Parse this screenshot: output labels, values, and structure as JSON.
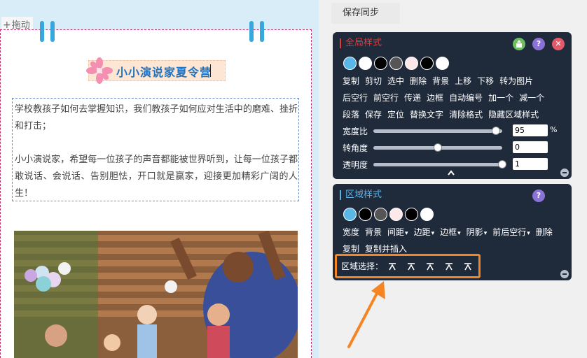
{
  "editor": {
    "drag_label": "拖动",
    "title": "小小演说家夏令营",
    "paragraph1": "学校教孩子如何去掌握知识，我们教孩子如何应对生活中的磨难、挫折和打击；",
    "paragraph2": "小小演说家，希望每一位孩子的声音都能被世界听到，让每一位孩子都敢说话、会说话、告别胆怯，开口就是赢家，迎接更加精彩广阔的人生！"
  },
  "toolbar": {
    "sync_label": "保存同步"
  },
  "global_panel": {
    "title": "全局样式",
    "swatch_colors": [
      "#5ab8e8",
      "#ffffff",
      "#000000",
      "#555555",
      "#fce8e8",
      "#000000",
      "#ffffff"
    ],
    "row1": [
      "复制",
      "剪切",
      "选中",
      "删除",
      "背景",
      "上移",
      "下移",
      "转为图片"
    ],
    "row2": [
      "后空行",
      "前空行",
      "传递",
      "边框",
      "自动编号",
      "加一个",
      "减一个"
    ],
    "row3": [
      "段落",
      "保存",
      "定位",
      "替换文字",
      "清除格式",
      "隐藏区域样式"
    ],
    "sliders": [
      {
        "label": "宽度比",
        "value": "95",
        "level": 0.95,
        "unit": "%"
      },
      {
        "label": "转角度",
        "value": "0",
        "level": 0.5,
        "unit": ""
      },
      {
        "label": "透明度",
        "value": "1",
        "level": 1.0,
        "unit": ""
      }
    ],
    "icons": {
      "a": "share-icon",
      "b": "help-icon",
      "c": "close-icon"
    },
    "help_glyph": "?",
    "close_glyph": "✕"
  },
  "region_panel": {
    "title": "区域样式",
    "help_glyph": "?",
    "swatch_colors": [
      "#5ab8e8",
      "#000000",
      "#555555",
      "#fce8e8",
      "#000000",
      "#ffffff"
    ],
    "row1": [
      "宽度",
      "背景",
      "间距",
      "边距",
      "边框",
      "阴影",
      "前后空行",
      "删除"
    ],
    "row1_dropdown": [
      false,
      false,
      true,
      true,
      true,
      true,
      true,
      false
    ],
    "row2": [
      "复制",
      "复制并插入"
    ],
    "select_label": "区域选择："
  },
  "colors": {
    "panel_bg": "#1f2a3b",
    "accent_blue": "#38a8dc",
    "highlight_orange": "#f58523",
    "title_blue": "#1f73c2"
  }
}
